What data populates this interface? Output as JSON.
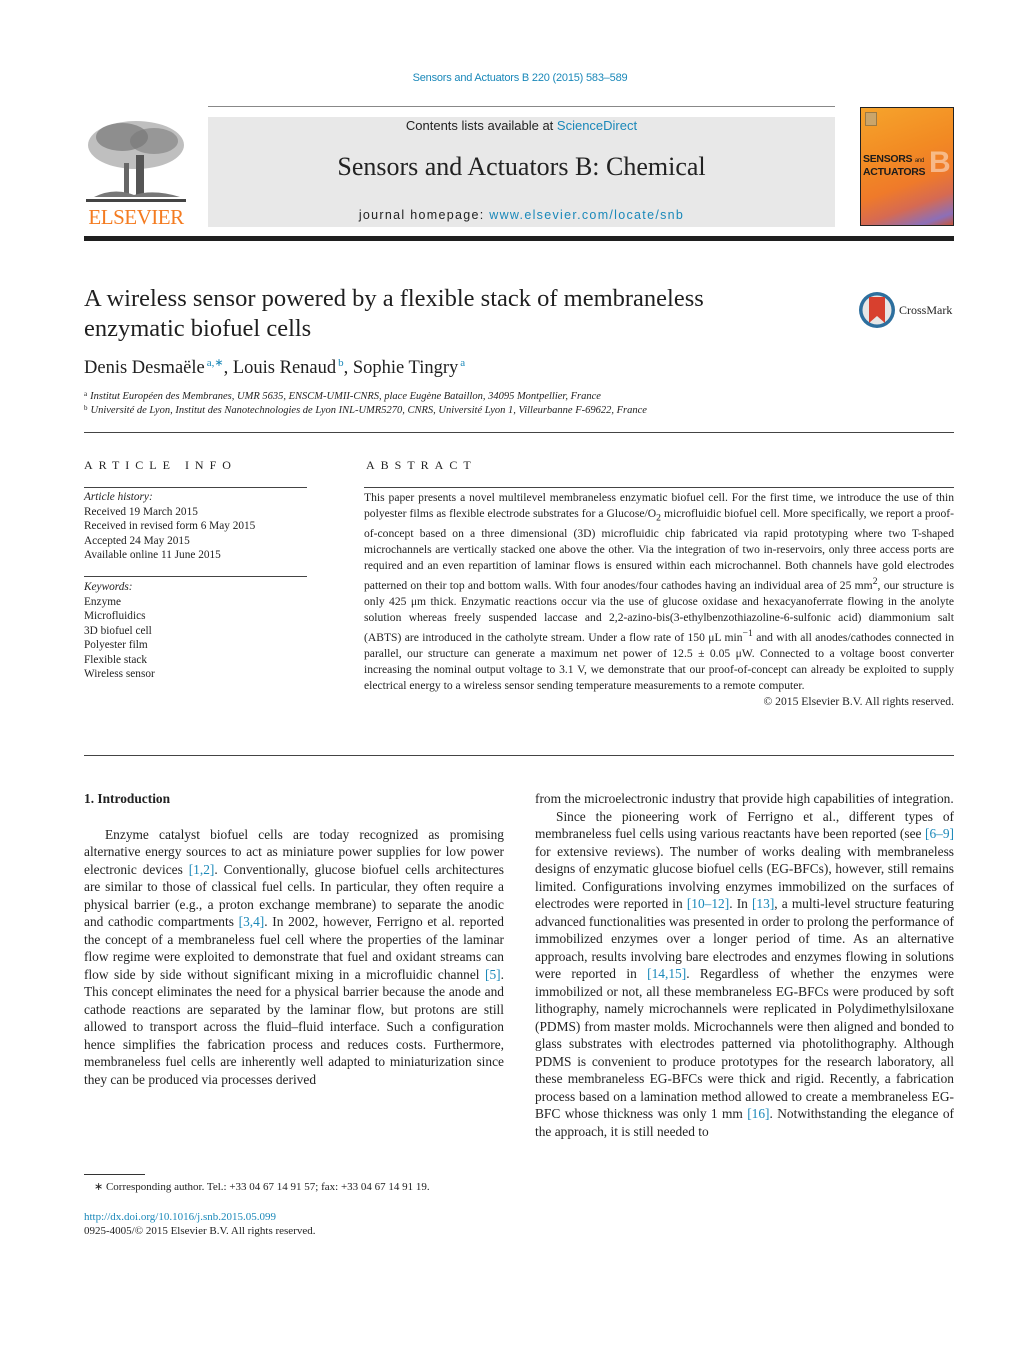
{
  "running_head": "Sensors and Actuators B 220 (2015) 583–589",
  "masthead": {
    "publisher_logo": "ELSEVIER",
    "contents_prefix": "Contents lists available at ",
    "contents_link": "ScienceDirect",
    "journal_title": "Sensors and Actuators B: Chemical",
    "homepage_prefix": "journal homepage: ",
    "homepage_link": "www.elsevier.com/locate/snb",
    "cover": {
      "line1": "SENSORS",
      "and": "and",
      "line2": "ACTUATORS",
      "letter": "B"
    }
  },
  "article": {
    "title": "A wireless sensor powered by a flexible stack of membraneless enzymatic biofuel cells",
    "crossmark_label": "CrossMark",
    "authors": [
      {
        "name": "Denis Desmaële",
        "sup": "a,∗"
      },
      {
        "name": "Louis Renaud",
        "sup": "b"
      },
      {
        "name": "Sophie Tingry",
        "sup": "a"
      }
    ],
    "affiliations": [
      {
        "mark": "a",
        "text": "Institut Européen des Membranes, UMR 5635, ENSCM-UMII-CNRS, place Eugène Bataillon, 34095 Montpellier, France"
      },
      {
        "mark": "b",
        "text": "Université de Lyon, Institut des Nanotechnologies de Lyon INL-UMR5270, CNRS, Université Lyon 1, Villeurbanne F-69622, France"
      }
    ]
  },
  "article_info": {
    "heading": "ARTICLE INFO",
    "history_label": "Article history:",
    "history": [
      "Received 19 March 2015",
      "Received in revised form 6 May 2015",
      "Accepted 24 May 2015",
      "Available online 11 June 2015"
    ],
    "keywords_label": "Keywords:",
    "keywords": [
      "Enzyme",
      "Microfluidics",
      "3D biofuel cell",
      "Polyester film",
      "Flexible stack",
      "Wireless sensor"
    ]
  },
  "abstract": {
    "heading": "ABSTRACT",
    "p1": "This paper presents a novel multilevel membraneless enzymatic biofuel cell. For the first time, we introduce the use of thin polyester films as flexible electrode substrates for a Glucose/O",
    "p1_sub": "2",
    "p2": " microfluidic biofuel cell. More specifically, we report a proof-of-concept based on a three dimensional (3D) microfluidic chip fabricated via rapid prototyping where two T-shaped microchannels are vertically stacked one above the other. Via the integration of two in-reservoirs, only three access ports are required and an even repartition of laminar flows is ensured within each microchannel. Both channels have gold electrodes patterned on their top and bottom walls. With four anodes/four cathodes having an individual area of 25 mm",
    "p2_sup": "2",
    "p3": ", our structure is only 425 μm thick. Enzymatic reactions occur via the use of glucose oxidase and hexacyanoferrate flowing in the anolyte solution whereas freely suspended laccase and 2,2-azino-bis(3-ethylbenzothiazoline-6-sulfonic acid) diammonium salt (ABTS) are introduced in the catholyte stream. Under a flow rate of 150 μL min",
    "p3_sup": "−1",
    "p4": " and with all anodes/cathodes connected in parallel, our structure can generate a maximum net power of 12.5 ± 0.05 μW. Connected to a voltage boost converter increasing the nominal output voltage to 3.1 V, we demonstrate that our proof-of-concept can already be exploited to supply electrical energy to a wireless sensor sending temperature measurements to a remote computer.",
    "copyright": "© 2015 Elsevier B.V. All rights reserved."
  },
  "body": {
    "intro_heading": "1.  Introduction",
    "left": [
      {
        "t": "Enzyme catalyst biofuel cells are today recognized as promising alternative energy sources to act as miniature power supplies for low power electronic devices "
      },
      {
        "ref": "[1,2]"
      },
      {
        "t": ". Conventionally, glucose biofuel cells architectures are similar to those of classical fuel cells. In particular, they often require a physical barrier (e.g., a proton exchange membrane) to separate the anodic and cathodic compartments "
      },
      {
        "ref": "[3,4]"
      },
      {
        "t": ". In 2002, however, Ferrigno et al. reported the concept of a membraneless fuel cell where the properties of the laminar flow regime were exploited to demonstrate that fuel and oxidant streams can flow side by side without significant mixing in a microfluidic channel "
      },
      {
        "ref": "[5]"
      },
      {
        "t": ". This concept eliminates the need for a physical barrier because the anode and cathode reactions are separated by the laminar flow, but protons are still allowed to transport across the fluid–fluid interface. Such a configuration hence simplifies the fabrication process and reduces costs. Furthermore, membraneless fuel cells are inherently well adapted to miniaturization since they can be produced via processes derived"
      }
    ],
    "right_p1": "from the microelectronic industry that provide high capabilities of integration.",
    "right_p2": [
      {
        "t": "Since the pioneering work of Ferrigno et al., different types of membraneless fuel cells using various reactants have been reported (see "
      },
      {
        "ref": "[6–9]"
      },
      {
        "t": " for extensive reviews). The number of works dealing with membraneless designs of enzymatic glucose biofuel cells (EG-BFCs), however, still remains limited. Configurations involving enzymes immobilized on the surfaces of electrodes were reported in "
      },
      {
        "ref": "[10–12]"
      },
      {
        "t": ". In "
      },
      {
        "ref": "[13]"
      },
      {
        "t": ", a multi-level structure featuring advanced functionalities was presented in order to prolong the performance of immobilized enzymes over a longer period of time. As an alternative approach, results involving bare electrodes and enzymes flowing in solutions were reported in "
      },
      {
        "ref": "[14,15]"
      },
      {
        "t": ". Regardless of whether the enzymes were immobilized or not, all these membraneless EG-BFCs were produced by soft lithography, namely microchannels were replicated in Polydimethylsiloxane (PDMS) from master molds. Microchannels were then aligned and bonded to glass substrates with electrodes patterned via photolithography. Although PDMS is convenient to produce prototypes for the research laboratory, all these membraneless EG-BFCs were thick and rigid. Recently, a fabrication process based on a lamination method allowed to create a membraneless EG-BFC whose thickness was only 1 mm "
      },
      {
        "ref": "[16]"
      },
      {
        "t": ". Notwithstanding the elegance of the approach, it is still needed to"
      }
    ]
  },
  "footer": {
    "footnote": "∗  Corresponding author. Tel.: +33 04 67 14 91 57; fax: +33 04 67 14 91 19.",
    "doi": "http://dx.doi.org/10.1016/j.snb.2015.05.099",
    "issn": "0925-4005/© 2015 Elsevier B.V. All rights reserved."
  },
  "colors": {
    "link": "#1a88b9",
    "elsevier_orange": "#f47b20",
    "masthead_bg": "#e8e8e8"
  }
}
